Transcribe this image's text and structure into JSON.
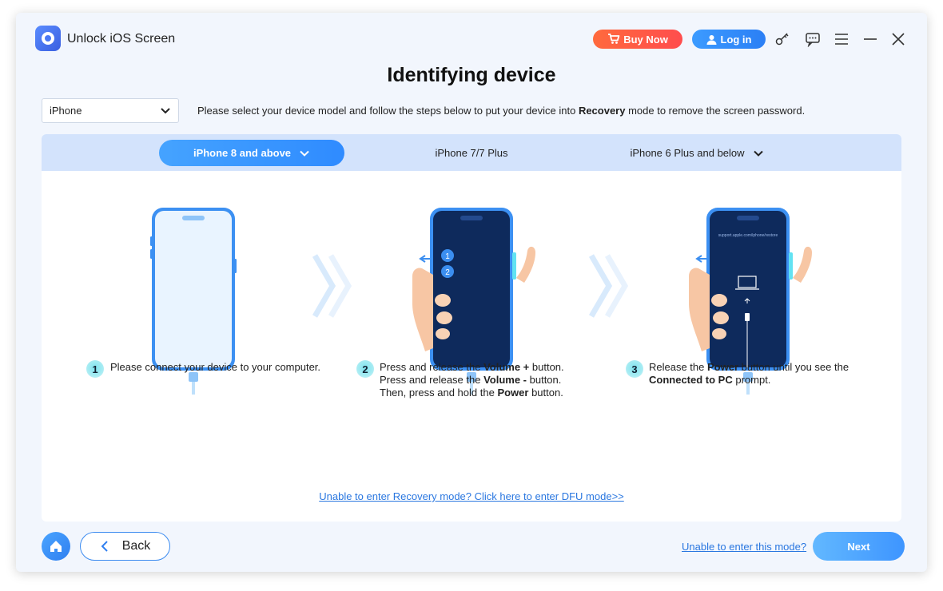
{
  "app": {
    "title": "Unlock iOS Screen",
    "buy_label": "Buy Now",
    "login_label": "Log in",
    "icons": [
      "cart-icon",
      "user-icon",
      "key-icon",
      "chat-icon",
      "menu-icon",
      "minimize-icon",
      "close-icon"
    ]
  },
  "page": {
    "title": "Identifying device",
    "model_select": {
      "value": "iPhone"
    },
    "instruction": {
      "before": "Please select your device model and follow the steps below to put your device into ",
      "bold": "Recovery",
      "after": " mode to remove the screen password."
    }
  },
  "tabs": [
    {
      "label": "iPhone 8 and above",
      "active": true
    },
    {
      "label": "iPhone 7/7 Plus",
      "active": false
    },
    {
      "label": "iPhone 6 Plus and below",
      "active": false
    }
  ],
  "illustration": {
    "screen_url_text": "support.apple.com/iphone/restore",
    "phone2_badges": [
      "1",
      "2"
    ]
  },
  "steps": [
    {
      "num": "1",
      "line1": "Please connect your device to your computer."
    },
    {
      "num": "2",
      "a1": "Press and release the ",
      "a2": "Volume +",
      "a3": " button.",
      "b1": "Press and release the ",
      "b2": "Volume -",
      "b3": " button.",
      "c1": "Then, press and hold the ",
      "c2": "Power",
      "c3": " button."
    },
    {
      "num": "3",
      "a1": "Release the ",
      "a2": "Power",
      "a3": " button until you see the",
      "b2": "Connected to PC",
      "b3": " prompt."
    }
  ],
  "dfu_link": "Unable to enter Recovery mode? Click here to enter DFU mode>>",
  "footer": {
    "back_label": "Back",
    "unable_link": "Unable to enter this mode?",
    "next_label": "Next"
  },
  "colors": {
    "accent": "#2f8bff",
    "buy": "#ff5545",
    "tabbar": "#d3e3fc",
    "window_bg": "#f2f6fd",
    "step_badge": "#a8ecf3"
  }
}
